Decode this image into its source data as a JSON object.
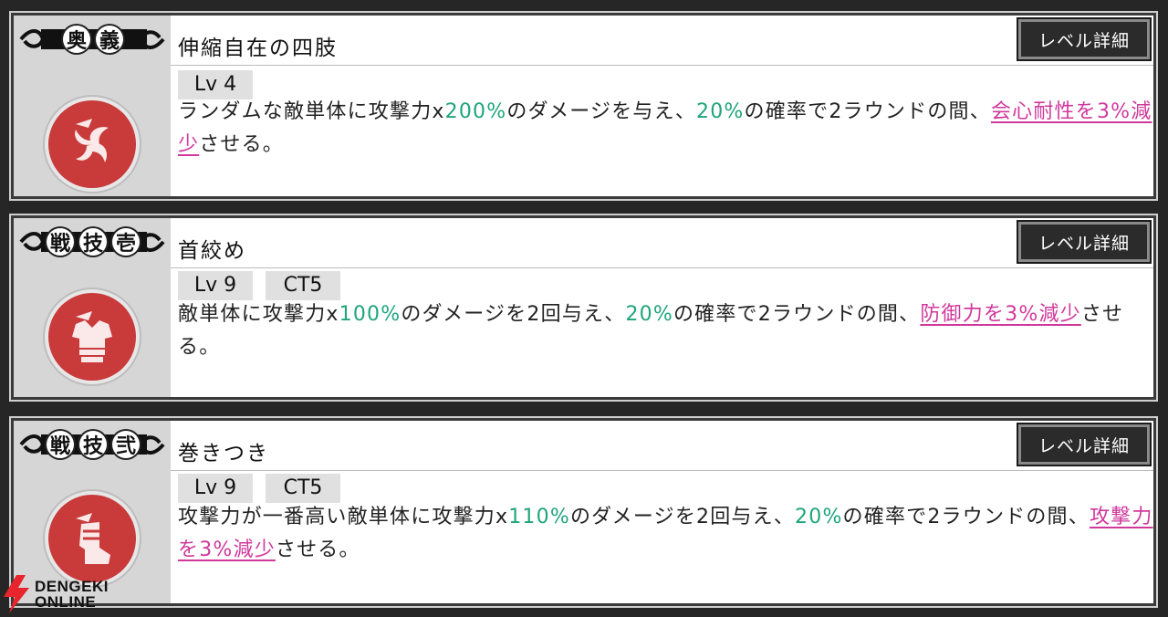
{
  "skills": [
    {
      "tag": [
        "奥",
        "義"
      ],
      "name": "伸縮自在の四肢",
      "detail_label": "レベル詳細",
      "level": "Lv 4",
      "ct": "",
      "icon": "spiral-claw-icon",
      "desc": [
        {
          "t": "ランダムな敵単体に攻撃力x",
          "s": ""
        },
        {
          "t": "200%",
          "s": "g"
        },
        {
          "t": "のダメージを与え、",
          "s": ""
        },
        {
          "t": "20%",
          "s": "g"
        },
        {
          "t": "の確率で2ラウンドの間、",
          "s": ""
        },
        {
          "t": "会心耐性を3%減少",
          "s": "p"
        },
        {
          "t": "させる。",
          "s": ""
        }
      ]
    },
    {
      "tag": [
        "戦",
        "技",
        "壱"
      ],
      "name": "首絞め",
      "detail_label": "レベル詳細",
      "level": "Lv 9",
      "ct": "CT5",
      "icon": "armor-icon",
      "desc": [
        {
          "t": "敵単体に攻撃力x",
          "s": ""
        },
        {
          "t": "100%",
          "s": "g"
        },
        {
          "t": "のダメージを2回与え、",
          "s": ""
        },
        {
          "t": "20%",
          "s": "g"
        },
        {
          "t": "の確率で2ラウンドの間、",
          "s": ""
        },
        {
          "t": "防御力を3%減少",
          "s": "p"
        },
        {
          "t": "させる。",
          "s": ""
        }
      ]
    },
    {
      "tag": [
        "戦",
        "技",
        "弐"
      ],
      "name": "巻きつき",
      "detail_label": "レベル詳細",
      "level": "Lv 9",
      "ct": "CT5",
      "icon": "boot-icon",
      "desc": [
        {
          "t": "攻撃力が一番高い敵単体に攻撃力x",
          "s": ""
        },
        {
          "t": "110%",
          "s": "g"
        },
        {
          "t": "のダメージを2回与え、",
          "s": ""
        },
        {
          "t": "20%",
          "s": "g"
        },
        {
          "t": "の確率で2ラウンドの間、",
          "s": ""
        },
        {
          "t": "攻撃力を3%減少",
          "s": "p"
        },
        {
          "t": "させる。",
          "s": ""
        }
      ]
    }
  ],
  "watermark": {
    "line1": "DENGEKI",
    "line2": "ONLINE",
    "color": "#e8242c"
  }
}
